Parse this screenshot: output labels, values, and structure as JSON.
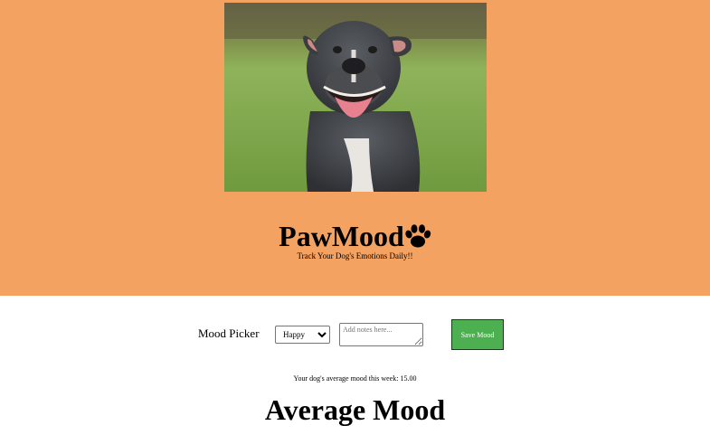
{
  "header": {
    "photo_alt": "Smiling grey pit bull dog sitting on grass",
    "title": "PawMood",
    "title_icon": "paw-icon",
    "tagline": "Track Your Dog's Emotions Daily!!"
  },
  "mood_form": {
    "label": "Mood Picker",
    "selected_mood": "Happy",
    "notes_placeholder": "Add notes here...",
    "notes_value": "",
    "save_label": "Save Mood"
  },
  "summary": {
    "average_text": "Your dog's average mood this week: 15.00",
    "heading": "Average Mood"
  },
  "colors": {
    "hero_background": "#f4a261",
    "save_button": "#4caf50"
  }
}
